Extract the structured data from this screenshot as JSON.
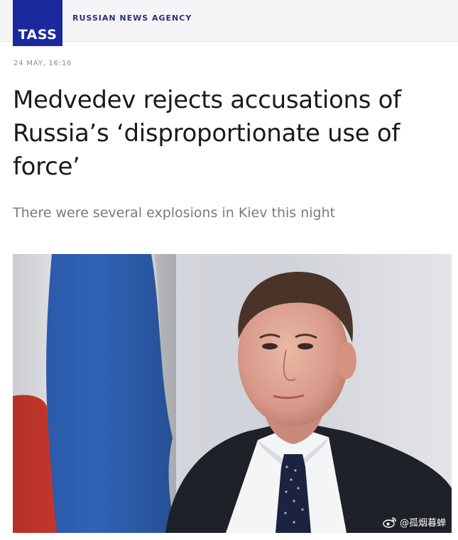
{
  "header": {
    "logo_text": "TASS",
    "agency_name": "RUSSIAN NEWS AGENCY",
    "brand_color": "#1a2a9e"
  },
  "article": {
    "timestamp": "24 MAY, 16:16",
    "headline": "Medvedev rejects accusations of Russia’s ‘disproportionate use of force’",
    "subheadline": "There were several explosions in Kiev this night",
    "photo_icon": "portrait-photo-icon"
  },
  "watermark": {
    "icon": "weibo-icon",
    "text": "@孤烟暮蝉"
  }
}
